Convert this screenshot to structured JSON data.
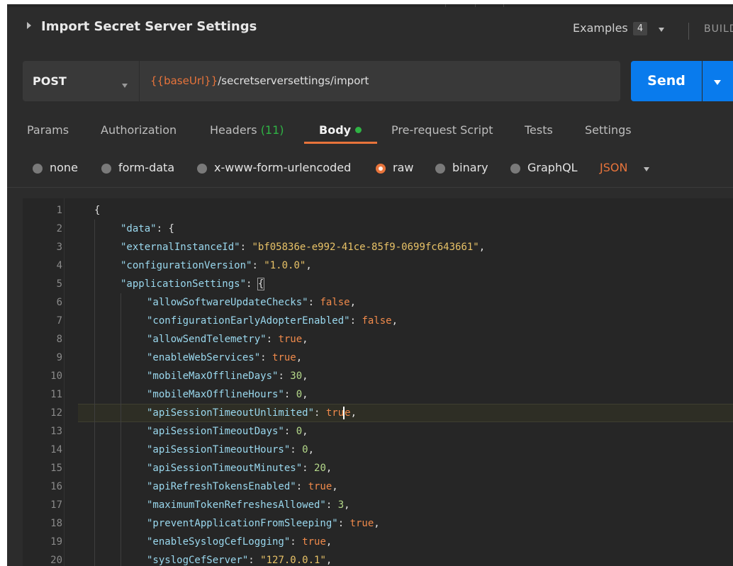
{
  "header": {
    "title": "Import Secret Server Settings",
    "examples_label": "Examples",
    "examples_count": "4",
    "build_label": "BUILD"
  },
  "request": {
    "method": "POST",
    "url_var": "{{baseUrl}}",
    "url_path": "/secretserversettings/import",
    "send_label": "Send"
  },
  "tabs": [
    {
      "label": "Params"
    },
    {
      "label": "Authorization"
    },
    {
      "label": "Headers",
      "count": "(11)"
    },
    {
      "label": "Body",
      "active": true
    },
    {
      "label": "Pre-request Script"
    },
    {
      "label": "Tests"
    },
    {
      "label": "Settings"
    }
  ],
  "body_types": [
    {
      "label": "none"
    },
    {
      "label": "form-data"
    },
    {
      "label": "x-www-form-urlencoded"
    },
    {
      "label": "raw",
      "selected": true
    },
    {
      "label": "binary"
    },
    {
      "label": "GraphQL"
    }
  ],
  "format_selector": "JSON",
  "editor": {
    "highlighted_line": 12,
    "lines": [
      {
        "n": "1",
        "text": "{"
      },
      {
        "n": "2",
        "text": "\"data\": {"
      },
      {
        "n": "3",
        "text": "\"externalInstanceId\": \"bf05836e-e992-41ce-85f9-0699fc643661\","
      },
      {
        "n": "4",
        "text": "\"configurationVersion\": \"1.0.0\","
      },
      {
        "n": "5",
        "text": "\"applicationSettings\": {"
      },
      {
        "n": "6",
        "text": "\"allowSoftwareUpdateChecks\": false,"
      },
      {
        "n": "7",
        "text": "\"configurationEarlyAdopterEnabled\": false,"
      },
      {
        "n": "8",
        "text": "\"allowSendTelemetry\": true,"
      },
      {
        "n": "9",
        "text": "\"enableWebServices\": true,"
      },
      {
        "n": "10",
        "text": "\"mobileMaxOfflineDays\": 30,"
      },
      {
        "n": "11",
        "text": "\"mobileMaxOfflineHours\": 0,"
      },
      {
        "n": "12",
        "text": "\"apiSessionTimeoutUnlimited\": true,"
      },
      {
        "n": "13",
        "text": "\"apiSessionTimeoutDays\": 0,"
      },
      {
        "n": "14",
        "text": "\"apiSessionTimeoutHours\": 0,"
      },
      {
        "n": "15",
        "text": "\"apiSessionTimeoutMinutes\": 20,"
      },
      {
        "n": "16",
        "text": "\"apiRefreshTokensEnabled\": true,"
      },
      {
        "n": "17",
        "text": "\"maximumTokenRefreshesAllowed\": 3,"
      },
      {
        "n": "18",
        "text": "\"preventApplicationFromSleeping\": true,"
      },
      {
        "n": "19",
        "text": "\"enableSyslogCefLogging\": true,"
      },
      {
        "n": "20",
        "text": "\"syslogCefServer\": \"127.0.0.1\","
      }
    ]
  },
  "colors": {
    "accent_orange": "#e8743b",
    "send_blue": "#097bed",
    "status_green": "#2fb344"
  }
}
